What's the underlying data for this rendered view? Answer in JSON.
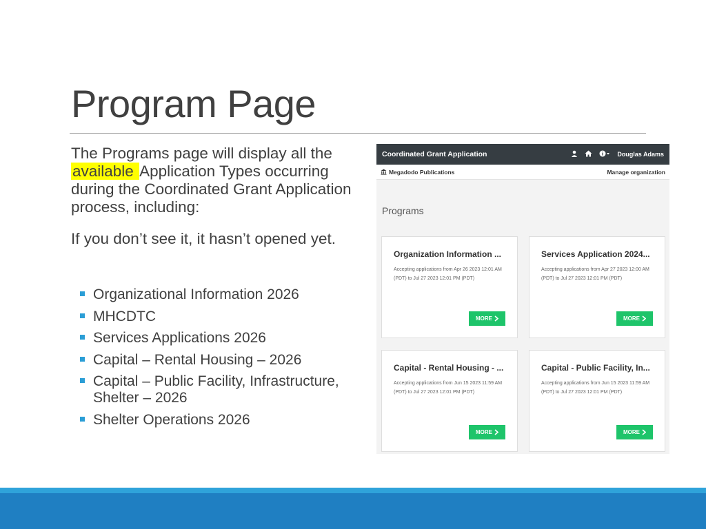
{
  "slide": {
    "title": "Program Page",
    "paragraph1_before": "The Programs page will display all the ",
    "paragraph1_highlight": "available ",
    "paragraph1_after": "Application Types occurring during the Coordinated Grant Application process, including:",
    "paragraph2": "If you don’t see it, it hasn’t opened yet.",
    "bullets": [
      "Organizational Information 2026",
      "MHCDTC",
      "Services Applications 2026",
      "Capital – Rental Housing – 2026",
      "Capital – Public Facility, Infrastructure, Shelter – 2026",
      "Shelter Operations 2026"
    ]
  },
  "screenshot": {
    "app_title": "Coordinated Grant Application",
    "user_name": "Douglas Adams",
    "org_name": "Megadodo Publications",
    "manage_link": "Manage organization",
    "heading": "Programs",
    "cards": [
      {
        "title": "Organization Information ...",
        "description": "Accepting applications from Apr 26 2023 12:01 AM (PDT) to Jul 27 2023 12:01 PM (PDT)",
        "button": "MORE"
      },
      {
        "title": "Services Application 2024...",
        "description": "Accepting applications from Apr 27 2023 12:00 AM (PDT) to Jul 27 2023 12:01 PM (PDT)",
        "button": "MORE"
      },
      {
        "title": "Capital - Rental Housing - ...",
        "description": "Accepting applications from Jun 15 2023 11:59 AM (PDT) to Jul 27 2023 12:01 PM (PDT)",
        "button": "MORE"
      },
      {
        "title": "Capital - Public Facility, In...",
        "description": "Accepting applications from Jun 15 2023 11:59 AM (PDT) to Jul 27 2023 12:01 PM (PDT)",
        "button": "MORE"
      }
    ]
  },
  "colors": {
    "accent": "#2b9ed6",
    "highlight": "#ffff00",
    "button_green": "#1ec46a",
    "navbar": "#363d42",
    "footer": "#1f7fc2"
  }
}
